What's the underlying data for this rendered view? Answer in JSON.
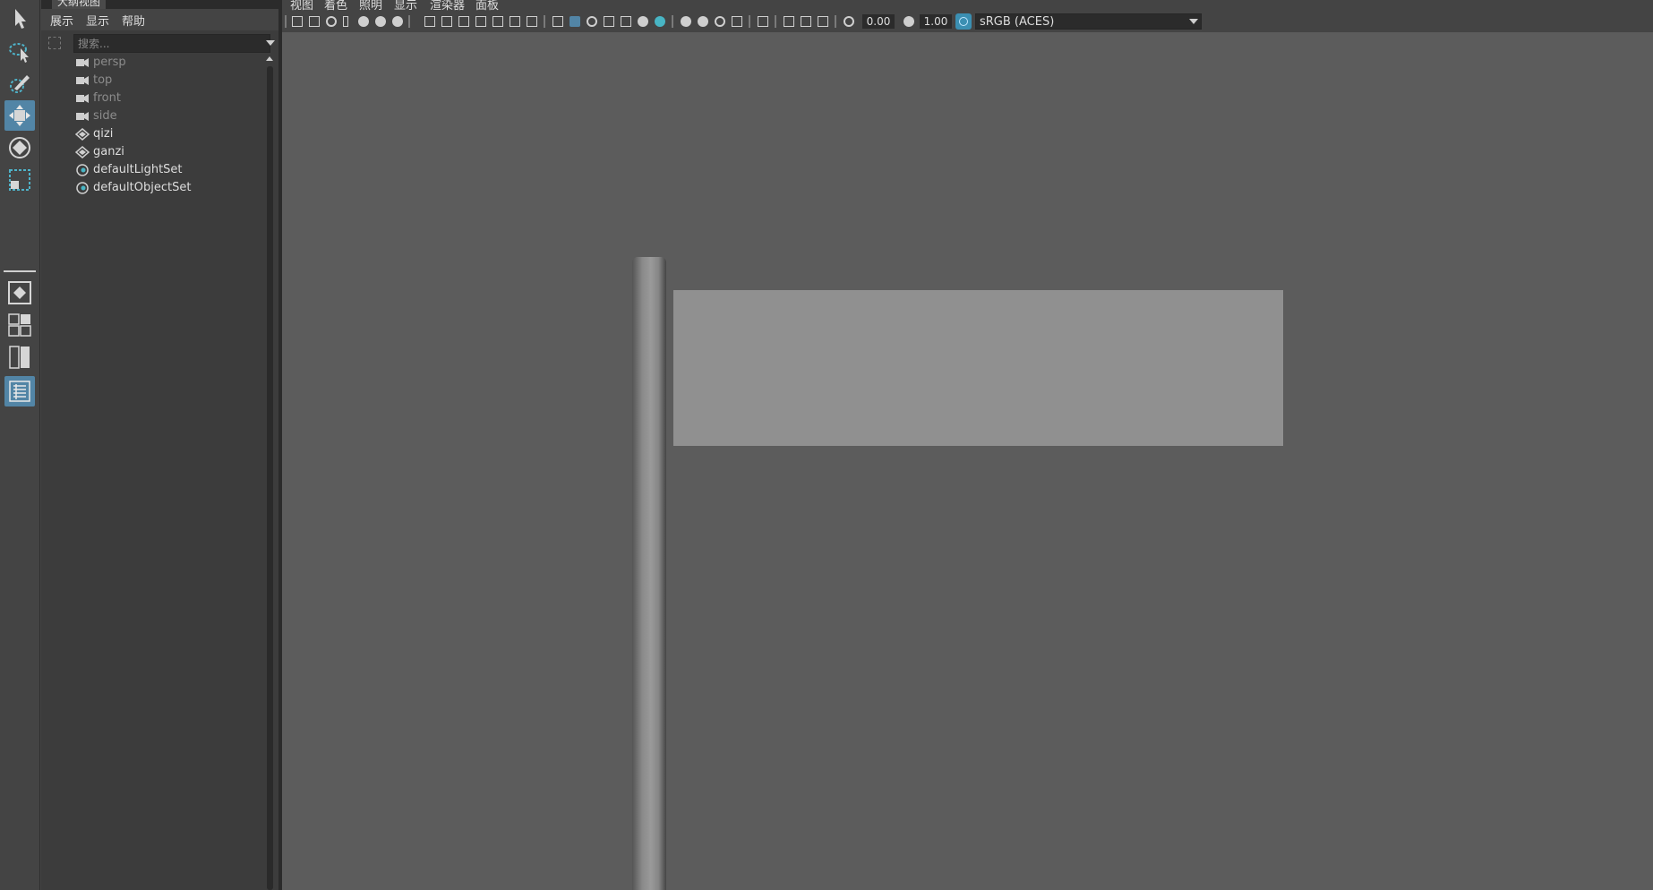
{
  "toolbox": {
    "tools": [
      {
        "name": "select-tool-icon",
        "active": false
      },
      {
        "name": "lasso-tool-icon",
        "active": false
      },
      {
        "name": "paint-select-tool-icon",
        "active": false
      },
      {
        "name": "move-tool-icon",
        "active": true
      },
      {
        "name": "rotate-tool-icon",
        "active": false
      },
      {
        "name": "scale-tool-icon",
        "active": false
      }
    ],
    "layout_buttons": [
      {
        "name": "single-perspective-layout-icon",
        "active": false
      },
      {
        "name": "four-view-layout-icon",
        "active": false
      },
      {
        "name": "two-view-layout-icon",
        "active": false
      },
      {
        "name": "outliner-layout-icon",
        "active": true
      }
    ]
  },
  "outliner": {
    "title": "大纲视图",
    "menu": [
      "展示",
      "显示",
      "帮助"
    ],
    "search": {
      "placeholder": "搜索...",
      "value": ""
    },
    "items": [
      {
        "label": "persp",
        "type": "camera",
        "icon": "camera-icon"
      },
      {
        "label": "top",
        "type": "camera",
        "icon": "camera-icon"
      },
      {
        "label": "front",
        "type": "camera",
        "icon": "camera-icon"
      },
      {
        "label": "side",
        "type": "camera",
        "icon": "camera-icon"
      },
      {
        "label": "qizi",
        "type": "mesh",
        "icon": "mesh-transform-icon"
      },
      {
        "label": "ganzi",
        "type": "mesh",
        "icon": "mesh-transform-icon"
      },
      {
        "label": "defaultLightSet",
        "type": "set",
        "icon": "object-set-icon"
      },
      {
        "label": "defaultObjectSet",
        "type": "set",
        "icon": "object-set-icon"
      }
    ]
  },
  "viewport": {
    "menu": [
      "视图",
      "着色",
      "照明",
      "显示",
      "渲染器",
      "面板"
    ],
    "exposure": "0.00",
    "gamma": "1.00",
    "color_space": "sRGB (ACES)",
    "colors": {
      "background": "#5c5c5c",
      "flag": "#909090",
      "pole": "#8a8a8a",
      "accent": "#5285a6"
    },
    "scene_objects": [
      "flagpole",
      "flag"
    ]
  }
}
